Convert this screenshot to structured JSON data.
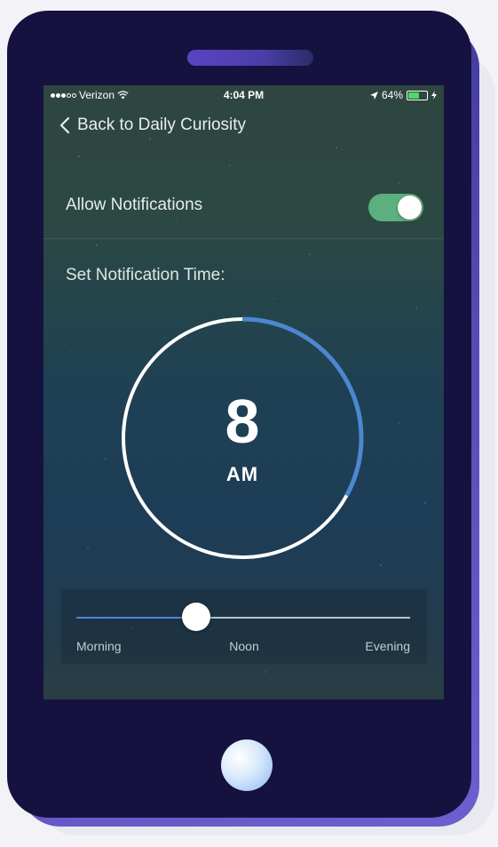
{
  "status_bar": {
    "carrier": "Verizon",
    "time": "4:04 PM",
    "battery": "64%",
    "battery_level": 0.64,
    "signal_bars_filled": 3,
    "signal_bars_total": 5
  },
  "nav": {
    "back_label": "Back to Daily Curiosity",
    "back_icon": "chevron-left-icon"
  },
  "settings": {
    "allow_notifications_label": "Allow Notifications",
    "allow_notifications_on": true,
    "set_time_label": "Set Notification Time:"
  },
  "time_dial": {
    "hour": "8",
    "ampm": "AM",
    "progress_fraction": 0.33
  },
  "time_slider": {
    "labels": [
      "Morning",
      "Noon",
      "Evening"
    ],
    "value_fraction": 0.36
  },
  "colors": {
    "accent_blue": "#4c88d0",
    "toggle_green": "#5bb07e",
    "phone_body": "#15123f"
  }
}
